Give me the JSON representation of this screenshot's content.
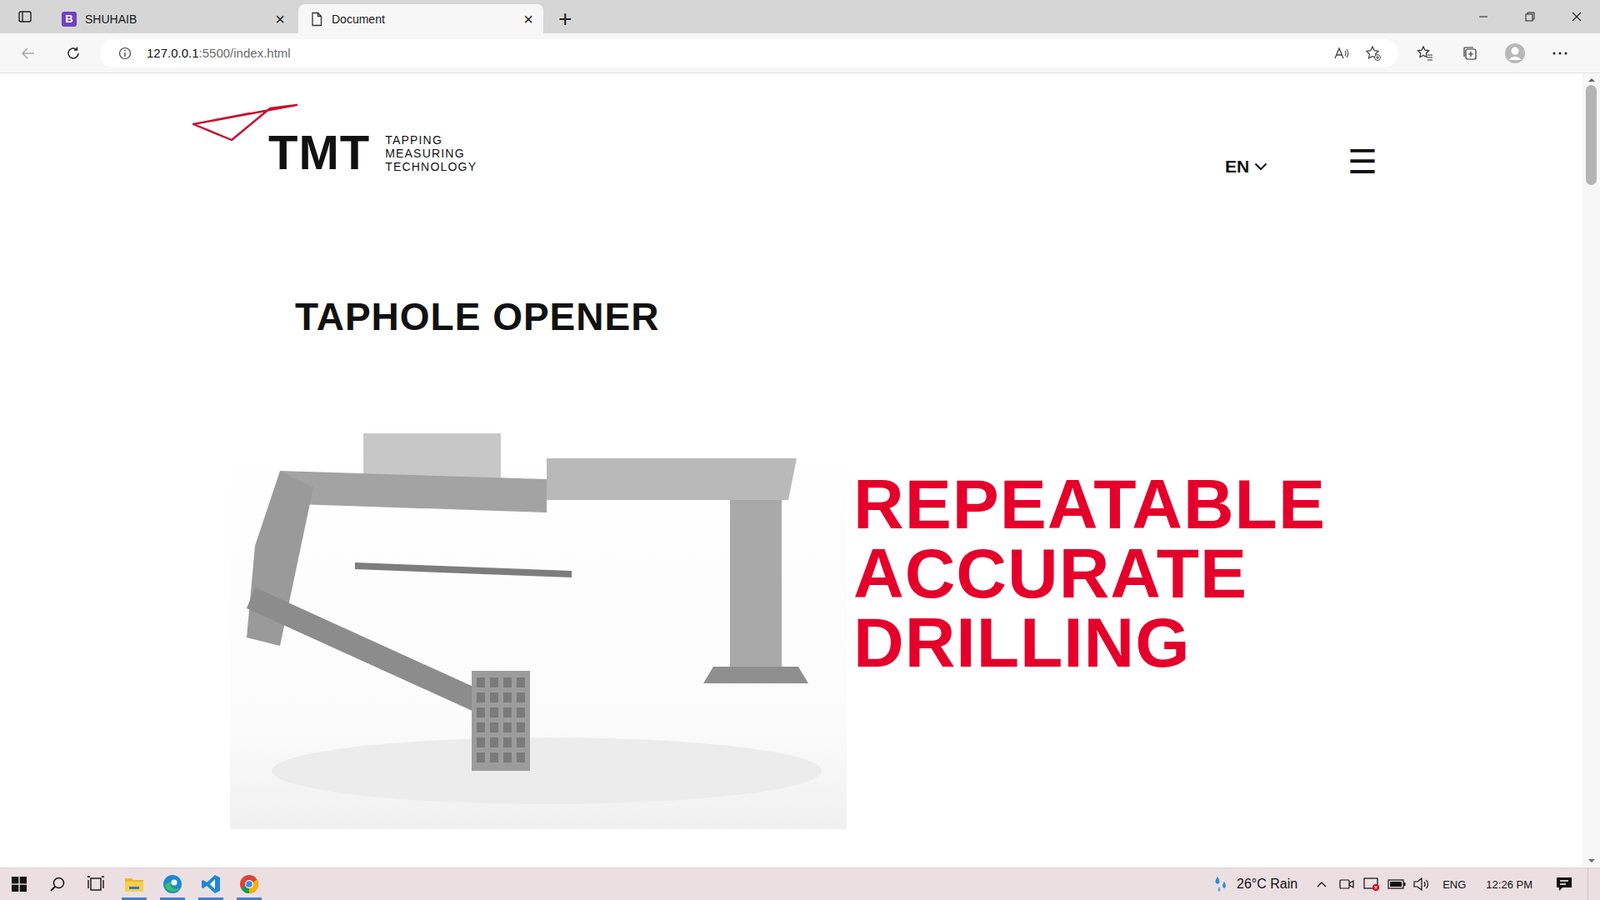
{
  "browser": {
    "tabs": [
      {
        "icon": "B",
        "label": "SHUHAIB",
        "close": "×",
        "selected": false
      },
      {
        "label": "Document",
        "close": "×",
        "selected": true
      }
    ],
    "new_tab": "+",
    "address": {
      "host": "127.0.0.1",
      "path": ":5500/index.html"
    }
  },
  "page": {
    "logo": {
      "mark": "TMT",
      "tagline": [
        "TAPPING",
        "MEASURING",
        "TECHNOLOGY"
      ]
    },
    "language": "EN",
    "menu": "☰",
    "heading": "TAPHOLE OPENER",
    "slogan": [
      "REPEATABLE",
      "ACCURATE",
      "DRILLING"
    ]
  },
  "taskbar": {
    "apps": [
      {
        "kind": "explorer",
        "running": true
      },
      {
        "kind": "edge",
        "running": true
      },
      {
        "kind": "vscode",
        "running": true
      },
      {
        "kind": "chrome",
        "running": true
      }
    ],
    "weather": {
      "temperature": "26°C",
      "condition": "Rain"
    },
    "input_language": "ENG",
    "time": "12:26 PM"
  }
}
